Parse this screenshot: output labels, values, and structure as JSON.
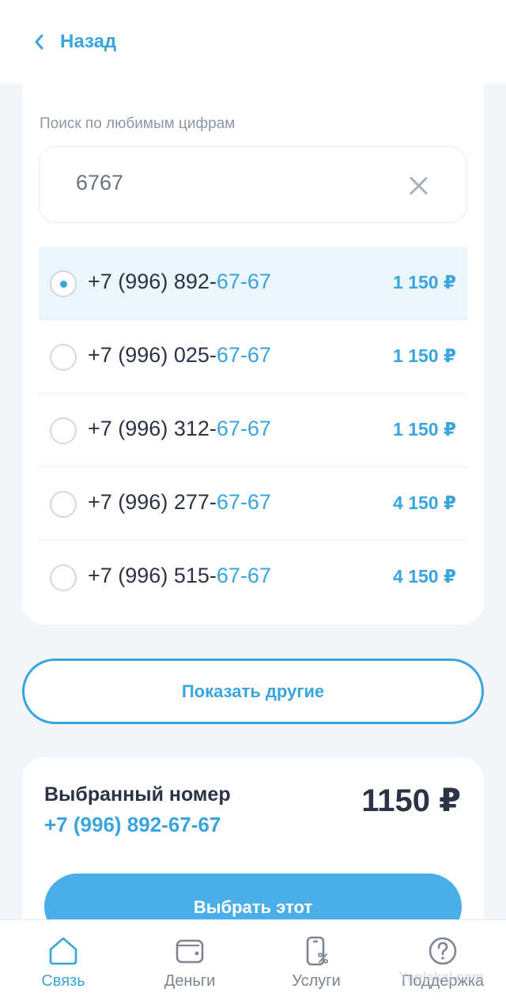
{
  "header": {
    "back_label": "Назад"
  },
  "search": {
    "label": "Поиск по любимым цифрам",
    "value": "6767"
  },
  "numbers": [
    {
      "prefix": "+7 (996) 892-",
      "highlight": "67-67",
      "price": "1 150 ₽",
      "selected": true
    },
    {
      "prefix": "+7 (996) 025-",
      "highlight": "67-67",
      "price": "1 150 ₽",
      "selected": false
    },
    {
      "prefix": "+7 (996) 312-",
      "highlight": "67-67",
      "price": "1 150 ₽",
      "selected": false
    },
    {
      "prefix": "+7 (996) 277-",
      "highlight": "67-67",
      "price": "4 150 ₽",
      "selected": false
    },
    {
      "prefix": "+7 (996) 515-",
      "highlight": "67-67",
      "price": "4 150 ₽",
      "selected": false
    }
  ],
  "show_more_label": "Показать другие",
  "selection": {
    "title": "Выбранный номер",
    "phone": "+7 (996) 892-67-67",
    "price": "1150 ₽",
    "button_label": "Выбрать этот"
  },
  "nav": {
    "items": [
      {
        "label": "Связь",
        "icon": "home-icon",
        "active": true
      },
      {
        "label": "Деньги",
        "icon": "wallet-icon",
        "active": false
      },
      {
        "label": "Услуги",
        "icon": "services-icon",
        "active": false
      },
      {
        "label": "Поддержка",
        "icon": "help-icon",
        "active": false
      }
    ]
  },
  "watermark": "Yaplakal.com",
  "colors": {
    "accent": "#3aa4dc",
    "button": "#4aaee8",
    "text": "#2b3344"
  }
}
